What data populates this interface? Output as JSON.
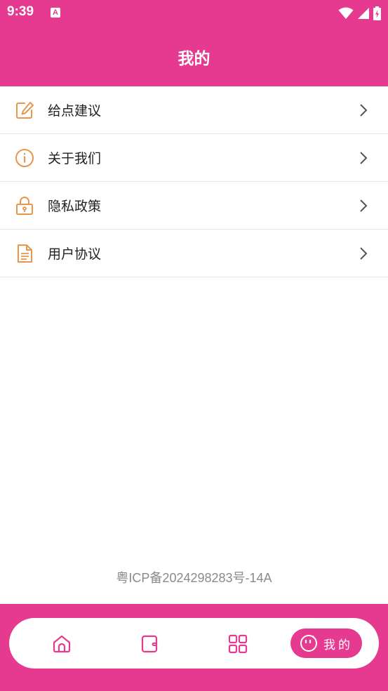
{
  "status_bar": {
    "time": "9:39",
    "app_icon": "A",
    "icons": [
      "wifi-icon",
      "cell-signal-icon",
      "battery-charging-icon"
    ]
  },
  "header": {
    "title": "我的"
  },
  "menu": {
    "items": [
      {
        "label": "给点建议",
        "icon": "edit-icon"
      },
      {
        "label": "关于我们",
        "icon": "info-icon"
      },
      {
        "label": "隐私政策",
        "icon": "lock-icon"
      },
      {
        "label": "用户协议",
        "icon": "document-icon"
      }
    ]
  },
  "footer": {
    "icp": "粤ICP备2024298283号-14A"
  },
  "tabbar": {
    "tabs": [
      {
        "icon": "home-icon"
      },
      {
        "icon": "wallet-icon"
      },
      {
        "icon": "grid-icon"
      },
      {
        "icon": "smiley-icon",
        "label": "我的",
        "active": true
      }
    ]
  },
  "colors": {
    "accent": "#E53A8F",
    "icon_orange": "#E8964A",
    "text": "#222222",
    "icp_text": "#8A8A8A"
  }
}
